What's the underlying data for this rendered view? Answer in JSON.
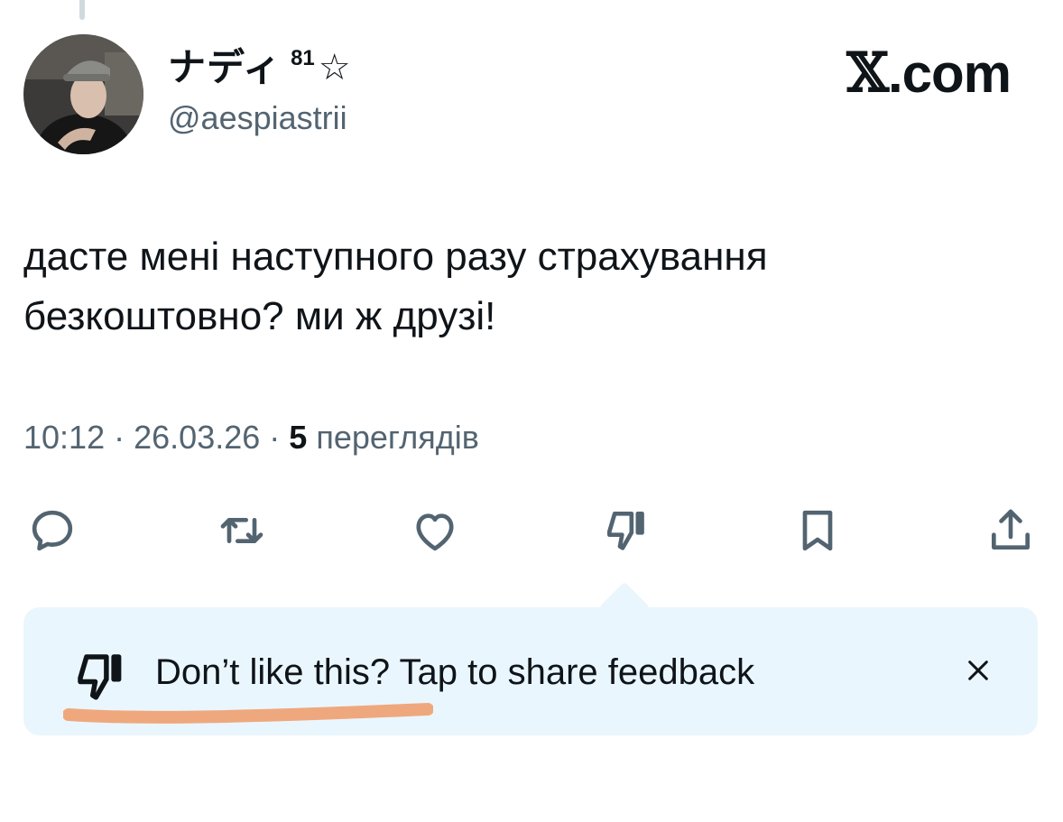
{
  "tweet": {
    "author": {
      "display_name": "ナディ",
      "superscript": "81",
      "star": "☆",
      "handle": "@aespiastrii",
      "avatar": "avatar-photo"
    },
    "brand": {
      "glyph": "𝕏",
      "suffix": ".com"
    },
    "text_line1": "даcте мені наступного разу страхування",
    "text_line2": "безкоштовно? ми ж друзі!",
    "meta": {
      "time": "10:12",
      "date": "26.03.26",
      "separator": "·",
      "views_count": "5",
      "views_label": "переглядів"
    },
    "actions": [
      {
        "icon": "reply-icon"
      },
      {
        "icon": "repost-icon"
      },
      {
        "icon": "like-icon"
      },
      {
        "icon": "dislike-icon"
      },
      {
        "icon": "bookmark-icon"
      },
      {
        "icon": "share-icon"
      }
    ]
  },
  "feedback_popup": {
    "icon": "dislike-icon",
    "text": "Don’t like this? Tap to share feedback",
    "close_icon": "close-icon",
    "background": "#eaf6fd",
    "highlight_color": "#f0a070"
  },
  "colors": {
    "text_primary": "#0f1419",
    "text_secondary": "#536471",
    "thread_line": "#cfd9de"
  }
}
